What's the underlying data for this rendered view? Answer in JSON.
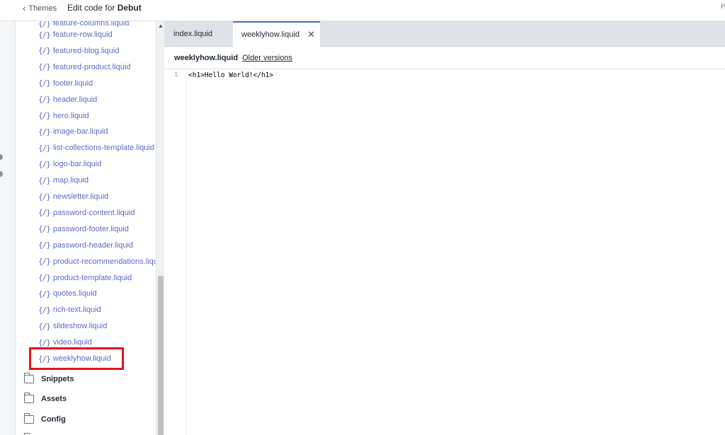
{
  "header": {
    "back_label": "Themes",
    "title_prefix": "Edit code for ",
    "theme_name": "Debut",
    "right_text": "P"
  },
  "sidebar": {
    "partial_top_file": "feature-columns.liquid",
    "file_icon": "{/}",
    "files": [
      "feature-row.liquid",
      "featured-blog.liquid",
      "featured-product.liquid",
      "footer.liquid",
      "header.liquid",
      "hero.liquid",
      "image-bar.liquid",
      "list-collections-template.liquid",
      "logo-bar.liquid",
      "map.liquid",
      "newsletter.liquid",
      "password-content.liquid",
      "password-footer.liquid",
      "password-header.liquid",
      "product-recommendations.liquid",
      "product-template.liquid",
      "quotes.liquid",
      "rich-text.liquid",
      "slideshow.liquid",
      "video.liquid",
      "weeklyhow.liquid"
    ],
    "highlighted_file": "weeklyhow.liquid",
    "folders": [
      "Snippets",
      "Assets",
      "Config"
    ]
  },
  "editor": {
    "tabs": [
      {
        "label": "index.liquid",
        "active": false
      },
      {
        "label": "weeklyhow.liquid",
        "active": true
      }
    ],
    "current_file": "weeklyhow.liquid",
    "older_versions_label": "Older versions",
    "lines": [
      {
        "number": "1",
        "code": "<h1>Hello World!</h1>"
      }
    ]
  },
  "colors": {
    "link": "#5c6ac4",
    "highlight_border": "#e0161e",
    "tab_bar": "#dfe3e8"
  }
}
